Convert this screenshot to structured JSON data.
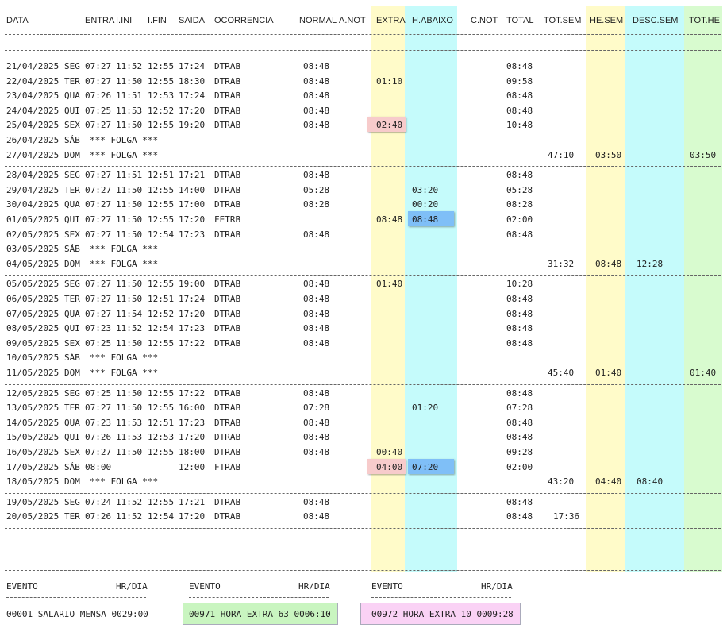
{
  "colors": {
    "extra": "#fffbc9",
    "habaixo": "#c5fbfb",
    "hesem": "#fffbc9",
    "descsem": "#c5fbfb",
    "tothe": "#d8fbcf",
    "highlight_red": "#f7cbcb",
    "highlight_blue": "#7fbff7",
    "total_green": "#c9f5c0",
    "total_pink": "#fad2f5"
  },
  "headers": {
    "data": "DATA",
    "entra": "ENTRA",
    "iini": "I.INI",
    "ifin": "I.FIN",
    "saida": "SAIDA",
    "ocorrencia": "OCORRENCIA",
    "normal": "NORMAL",
    "anot": "A.NOT",
    "extra": "EXTRA",
    "habaixo": "H.ABAIXO",
    "cnot": "C.NOT",
    "total": "TOTAL",
    "totsem": "TOT.SEM",
    "hesem": "HE.SEM",
    "descsem": "DESC.SEM",
    "tothe": "TOT.HE"
  },
  "rows": [
    {
      "date": "21/04/2025",
      "day": "SEG",
      "entra": "07:27",
      "iini": "11:52",
      "ifin": "12:55",
      "saida": "17:24",
      "oc": "DTRAB",
      "normal": "08:48",
      "extra": "",
      "habaixo": "",
      "total": "08:48",
      "totsem": "",
      "hesem": "",
      "descsem": "",
      "tothe": ""
    },
    {
      "date": "22/04/2025",
      "day": "TER",
      "entra": "07:27",
      "iini": "11:50",
      "ifin": "12:55",
      "saida": "18:30",
      "oc": "DTRAB",
      "normal": "08:48",
      "extra": "01:10",
      "habaixo": "",
      "total": "09:58",
      "totsem": "",
      "hesem": "",
      "descsem": "",
      "tothe": ""
    },
    {
      "date": "23/04/2025",
      "day": "QUA",
      "entra": "07:26",
      "iini": "11:51",
      "ifin": "12:53",
      "saida": "17:24",
      "oc": "DTRAB",
      "normal": "08:48",
      "extra": "",
      "habaixo": "",
      "total": "08:48",
      "totsem": "",
      "hesem": "",
      "descsem": "",
      "tothe": ""
    },
    {
      "date": "24/04/2025",
      "day": "QUI",
      "entra": "07:25",
      "iini": "11:53",
      "ifin": "12:52",
      "saida": "17:20",
      "oc": "DTRAB",
      "normal": "08:48",
      "extra": "",
      "habaixo": "",
      "total": "08:48",
      "totsem": "",
      "hesem": "",
      "descsem": "",
      "tothe": ""
    },
    {
      "date": "25/04/2025",
      "day": "SEX",
      "entra": "07:27",
      "iini": "11:50",
      "ifin": "12:55",
      "saida": "19:20",
      "oc": "DTRAB",
      "normal": "08:48",
      "extra": "02:40",
      "extra_hl": "red",
      "habaixo": "",
      "total": "10:48",
      "totsem": "",
      "hesem": "",
      "descsem": "",
      "tothe": ""
    },
    {
      "date": "26/04/2025",
      "day": "SÁB",
      "folga": "*** FOLGA ***",
      "total": "",
      "totsem": "",
      "hesem": "",
      "descsem": "",
      "tothe": ""
    },
    {
      "date": "27/04/2025",
      "day": "DOM",
      "folga": "*** FOLGA ***",
      "total": "",
      "totsem": "47:10",
      "hesem": "03:50",
      "descsem": "",
      "tothe": "03:50",
      "week_end": true
    },
    {
      "date": "28/04/2025",
      "day": "SEG",
      "entra": "07:27",
      "iini": "11:51",
      "ifin": "12:51",
      "saida": "17:21",
      "oc": "DTRAB",
      "normal": "08:48",
      "extra": "",
      "habaixo": "",
      "total": "08:48"
    },
    {
      "date": "29/04/2025",
      "day": "TER",
      "entra": "07:27",
      "iini": "11:50",
      "ifin": "12:55",
      "saida": "14:00",
      "oc": "DTRAB",
      "normal": "05:28",
      "extra": "",
      "habaixo": "03:20",
      "total": "05:28"
    },
    {
      "date": "30/04/2025",
      "day": "QUA",
      "entra": "07:27",
      "iini": "11:50",
      "ifin": "12:55",
      "saida": "17:00",
      "oc": "DTRAB",
      "normal": "08:28",
      "extra": "",
      "habaixo": "00:20",
      "total": "08:28"
    },
    {
      "date": "01/05/2025",
      "day": "QUI",
      "entra": "07:27",
      "iini": "11:50",
      "ifin": "12:55",
      "saida": "17:20",
      "oc": "FETRB",
      "normal": "",
      "extra": "08:48",
      "habaixo": "08:48",
      "habaixo_hl": "blue",
      "total": "02:00"
    },
    {
      "date": "02/05/2025",
      "day": "SEX",
      "entra": "07:27",
      "iini": "11:50",
      "ifin": "12:54",
      "saida": "17:23",
      "oc": "DTRAB",
      "normal": "08:48",
      "extra": "",
      "habaixo": "",
      "total": "08:48"
    },
    {
      "date": "03/05/2025",
      "day": "SÁB",
      "folga": "*** FOLGA ***",
      "total": ""
    },
    {
      "date": "04/05/2025",
      "day": "DOM",
      "folga": "*** FOLGA ***",
      "total": "",
      "totsem": "31:32",
      "hesem": "08:48",
      "descsem": "12:28",
      "tothe": "",
      "week_end": true
    },
    {
      "date": "05/05/2025",
      "day": "SEG",
      "entra": "07:27",
      "iini": "11:50",
      "ifin": "12:55",
      "saida": "19:00",
      "oc": "DTRAB",
      "normal": "08:48",
      "extra": "01:40",
      "habaixo": "",
      "total": "10:28"
    },
    {
      "date": "06/05/2025",
      "day": "TER",
      "entra": "07:27",
      "iini": "11:50",
      "ifin": "12:51",
      "saida": "17:24",
      "oc": "DTRAB",
      "normal": "08:48",
      "extra": "",
      "habaixo": "",
      "total": "08:48"
    },
    {
      "date": "07/05/2025",
      "day": "QUA",
      "entra": "07:27",
      "iini": "11:54",
      "ifin": "12:52",
      "saida": "17:20",
      "oc": "DTRAB",
      "normal": "08:48",
      "extra": "",
      "habaixo": "",
      "total": "08:48"
    },
    {
      "date": "08/05/2025",
      "day": "QUI",
      "entra": "07:23",
      "iini": "11:52",
      "ifin": "12:54",
      "saida": "17:23",
      "oc": "DTRAB",
      "normal": "08:48",
      "extra": "",
      "habaixo": "",
      "total": "08:48"
    },
    {
      "date": "09/05/2025",
      "day": "SEX",
      "entra": "07:25",
      "iini": "11:50",
      "ifin": "12:55",
      "saida": "17:22",
      "oc": "DTRAB",
      "normal": "08:48",
      "extra": "",
      "habaixo": "",
      "total": "08:48"
    },
    {
      "date": "10/05/2025",
      "day": "SÁB",
      "folga": "*** FOLGA ***",
      "total": ""
    },
    {
      "date": "11/05/2025",
      "day": "DOM",
      "folga": "*** FOLGA ***",
      "total": "",
      "totsem": "45:40",
      "hesem": "01:40",
      "descsem": "",
      "tothe": "01:40",
      "week_end": true
    },
    {
      "date": "12/05/2025",
      "day": "SEG",
      "entra": "07:25",
      "iini": "11:50",
      "ifin": "12:55",
      "saida": "17:22",
      "oc": "DTRAB",
      "normal": "08:48",
      "extra": "",
      "habaixo": "",
      "total": "08:48"
    },
    {
      "date": "13/05/2025",
      "day": "TER",
      "entra": "07:27",
      "iini": "11:50",
      "ifin": "12:55",
      "saida": "16:00",
      "oc": "DTRAB",
      "normal": "07:28",
      "extra": "",
      "habaixo": "01:20",
      "total": "07:28"
    },
    {
      "date": "14/05/2025",
      "day": "QUA",
      "entra": "07:23",
      "iini": "11:53",
      "ifin": "12:51",
      "saida": "17:23",
      "oc": "DTRAB",
      "normal": "08:48",
      "extra": "",
      "habaixo": "",
      "total": "08:48"
    },
    {
      "date": "15/05/2025",
      "day": "QUI",
      "entra": "07:26",
      "iini": "11:53",
      "ifin": "12:53",
      "saida": "17:20",
      "oc": "DTRAB",
      "normal": "08:48",
      "extra": "",
      "habaixo": "",
      "total": "08:48"
    },
    {
      "date": "16/05/2025",
      "day": "SEX",
      "entra": "07:27",
      "iini": "11:50",
      "ifin": "12:55",
      "saida": "18:00",
      "oc": "DTRAB",
      "normal": "08:48",
      "extra": "00:40",
      "habaixo": "",
      "total": "09:28"
    },
    {
      "date": "17/05/2025",
      "day": "SÁB",
      "entra": "08:00",
      "iini": "",
      "ifin": "",
      "saida": "12:00",
      "oc": "FTRAB",
      "normal": "",
      "extra": "04:00",
      "extra_hl": "red",
      "habaixo": "07:20",
      "habaixo_hl": "blue",
      "total": "02:00"
    },
    {
      "date": "18/05/2025",
      "day": "DOM",
      "folga": "*** FOLGA ***",
      "total": "",
      "totsem": "43:20",
      "hesem": "04:40",
      "descsem": "08:40",
      "tothe": "",
      "week_end": true
    },
    {
      "date": "19/05/2025",
      "day": "SEG",
      "entra": "07:24",
      "iini": "11:52",
      "ifin": "12:55",
      "saida": "17:21",
      "oc": "DTRAB",
      "normal": "08:48",
      "extra": "",
      "habaixo": "",
      "total": "08:48"
    },
    {
      "date": "20/05/2025",
      "day": "TER",
      "entra": "07:26",
      "iini": "11:52",
      "ifin": "12:54",
      "saida": "17:20",
      "oc": "DTRAB",
      "normal": "08:48",
      "extra": "",
      "habaixo": "",
      "total": "08:48",
      "totsem": "17:36",
      "week_end": true
    }
  ],
  "footer": {
    "evento_label": "EVENTO",
    "hrdia_label": "HR/DIA",
    "items": [
      {
        "text": "00001 SALARIO MENSA 0029:00",
        "style": "plain"
      },
      {
        "text": "00971 HORA EXTRA 63 0006:10",
        "style": "green"
      },
      {
        "text": "00972 HORA EXTRA 10 0009:28",
        "style": "pink"
      }
    ]
  }
}
